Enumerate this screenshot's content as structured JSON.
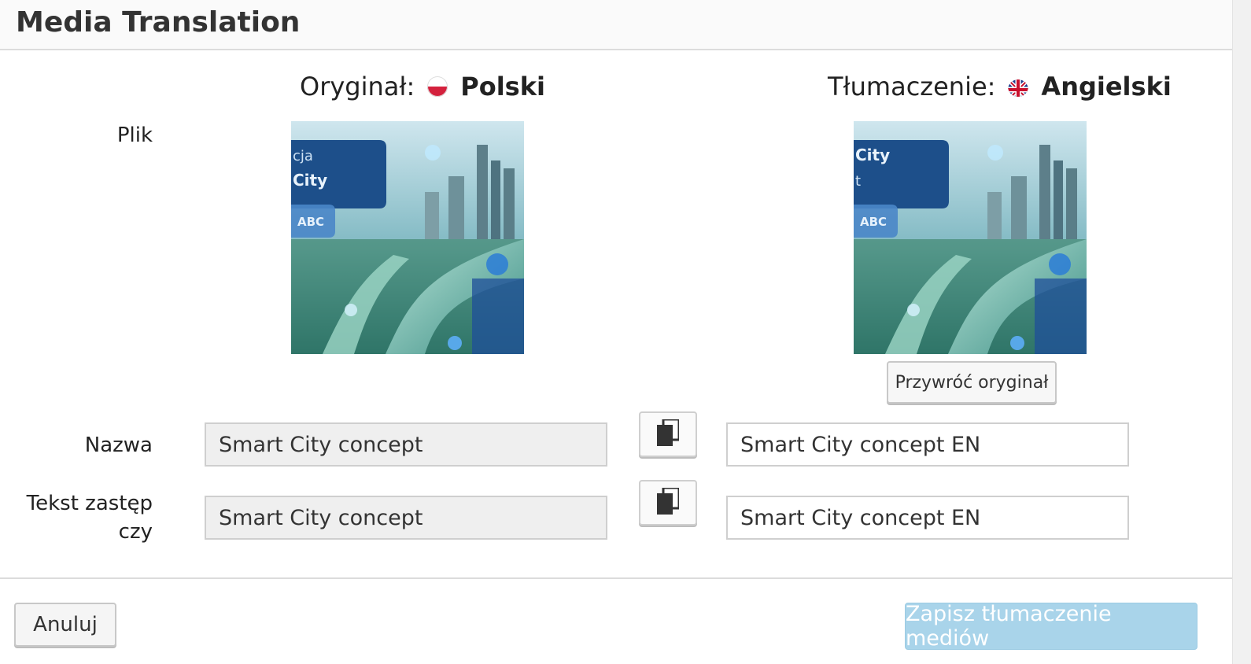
{
  "header": {
    "title": "Media Translation"
  },
  "original": {
    "caption": "Oryginał:",
    "language": "Polski",
    "flag_icon": "poland-flag-icon"
  },
  "translation": {
    "caption": "Tłumaczenie:",
    "language": "Angielski",
    "flag_icon": "uk-flag-icon"
  },
  "labels": {
    "file": "Plik",
    "name": "Nazwa",
    "alt_line1": "Tekst zastęp",
    "alt_line2": "czy"
  },
  "media": {
    "original_image": {
      "overlay_line1": "cja",
      "overlay_line2": "City",
      "badge": "ABC"
    },
    "translated_image": {
      "overlay_line1": "City",
      "overlay_line2": "t",
      "badge": "ABC"
    },
    "restore_label": "Przywróć oryginał"
  },
  "fields": {
    "name_original": "Smart City concept",
    "name_translation": "Smart City concept EN",
    "alt_original": "Smart City concept",
    "alt_translation": "Smart City concept EN"
  },
  "icons": {
    "copy": "copy-icon"
  },
  "footer": {
    "cancel_label": "Anuluj",
    "save_label": "Zapisz tłumaczenie mediów"
  },
  "colors": {
    "save_button": "#a9d4ea",
    "readonly_field": "#efefef",
    "poland_red": "#d4213d",
    "uk_blue": "#1f3f8f"
  }
}
